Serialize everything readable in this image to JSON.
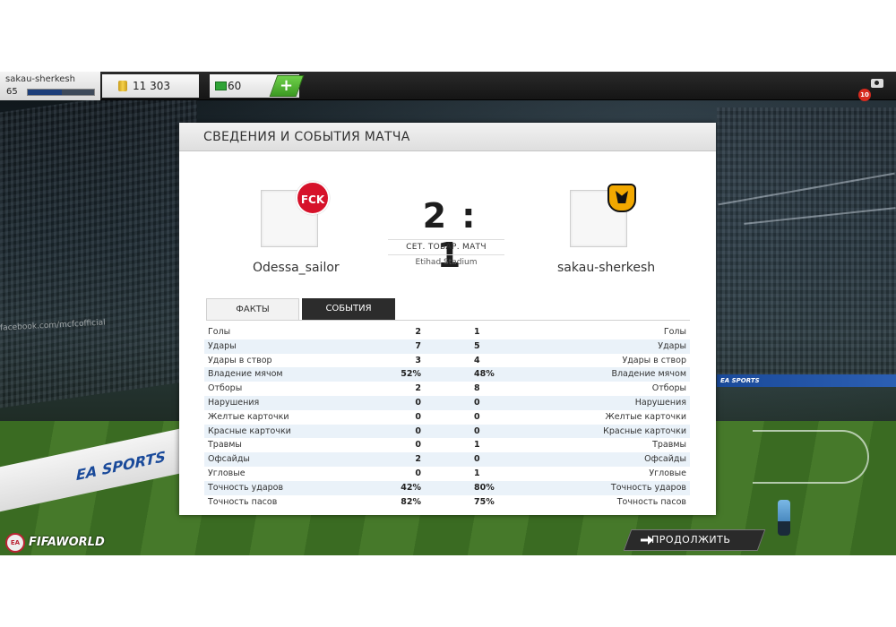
{
  "topbar": {
    "username": "sakau-sherkesh",
    "level": "65",
    "xp_progress": 0.52,
    "coins": "11 303",
    "points": "60",
    "add_points_label": "+",
    "notifications": "10"
  },
  "panel": {
    "title": "СВЕДЕНИЯ И СОБЫТИЯ МАТЧА",
    "home_team": "Odessa_sailor",
    "away_team": "sakau-sherkesh",
    "home_badge": "FCK",
    "score": "2 : 1",
    "match_type": "СЕТ. ТОВАР. МАТЧ",
    "stadium": "Etihad Stadium",
    "tabs": [
      {
        "label": "ФАКТЫ",
        "active": true
      },
      {
        "label": "СОБЫТИЯ",
        "active": false
      }
    ],
    "stats": [
      {
        "label": "Голы",
        "home": "2",
        "away": "1"
      },
      {
        "label": "Удары",
        "home": "7",
        "away": "5"
      },
      {
        "label": "Удары в створ",
        "home": "3",
        "away": "4"
      },
      {
        "label": "Владение мячом",
        "home": "52%",
        "away": "48%"
      },
      {
        "label": "Отборы",
        "home": "2",
        "away": "8"
      },
      {
        "label": "Нарушения",
        "home": "0",
        "away": "0"
      },
      {
        "label": "Желтые карточки",
        "home": "0",
        "away": "0"
      },
      {
        "label": "Красные карточки",
        "home": "0",
        "away": "0"
      },
      {
        "label": "Травмы",
        "home": "0",
        "away": "1"
      },
      {
        "label": "Офсайды",
        "home": "2",
        "away": "0"
      },
      {
        "label": "Угловые",
        "home": "0",
        "away": "1"
      },
      {
        "label": "Точность ударов",
        "home": "42%",
        "away": "80%"
      },
      {
        "label": "Точность пасов",
        "home": "82%",
        "away": "75%"
      }
    ]
  },
  "footer": {
    "logo_text": "FIFAWORLD",
    "ea_text": "EA",
    "continue_label": "ПРОДОЛЖИТЬ"
  },
  "background": {
    "adboard_text": "EA SPORTS",
    "banner_text": "facebook.com/mcfcofficial"
  },
  "colors": {
    "accent_green": "#3c9a23",
    "tab_dark": "#2c2c2c",
    "row_alt": "#eaf2f9",
    "badge_red": "#d6122a",
    "badge_gold": "#f2a800"
  }
}
